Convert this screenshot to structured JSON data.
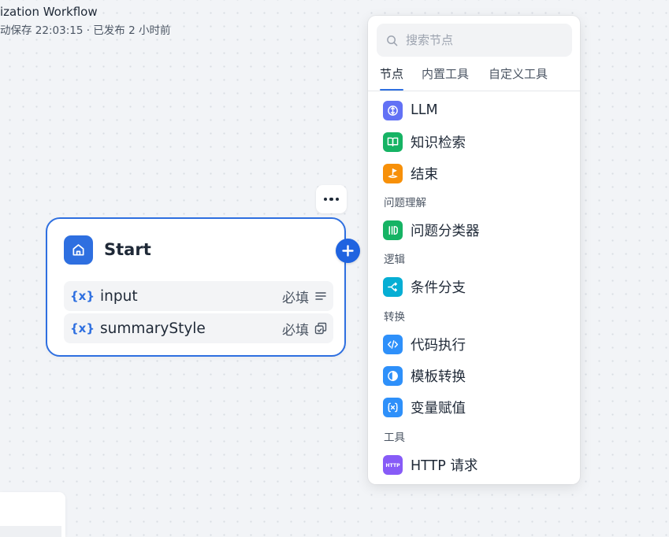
{
  "header": {
    "title": "ization Workflow",
    "subtitle": "动保存 22:03:15 · 已发布 2 小时前"
  },
  "start_node": {
    "title": "Start",
    "icon": "home-icon",
    "variables": [
      {
        "tag": "{x}",
        "name": "input",
        "required": "必填",
        "type_icon": "text-lines-icon"
      },
      {
        "tag": "{x}",
        "name": "summaryStyle",
        "required": "必填",
        "type_icon": "select-copy-icon"
      }
    ]
  },
  "panel": {
    "search_placeholder": "搜索节点",
    "tabs": [
      {
        "label": "节点",
        "active": true
      },
      {
        "label": "内置工具",
        "active": false
      },
      {
        "label": "自定义工具",
        "active": false
      }
    ],
    "items": [
      {
        "label": "LLM",
        "icon": "llm-icon",
        "color": "#6271f5"
      },
      {
        "label": "知识检索",
        "icon": "book-icon",
        "color": "#16b364"
      },
      {
        "label": "结束",
        "icon": "end-flag-icon",
        "color": "#f79009"
      },
      {
        "label": "问题分类器",
        "icon": "classifier-icon",
        "color": "#16b364"
      },
      {
        "label": "条件分支",
        "icon": "branch-icon",
        "color": "#06aed4"
      },
      {
        "label": "代码执行",
        "icon": "code-icon",
        "color": "#2e90fa"
      },
      {
        "label": "模板转换",
        "icon": "template-icon",
        "color": "#2e90fa"
      },
      {
        "label": "变量赋值",
        "icon": "variable-icon",
        "color": "#2e90fa"
      },
      {
        "label": "HTTP 请求",
        "icon": "http-icon",
        "color": "#875bf7"
      }
    ],
    "sections": [
      "问题理解",
      "逻辑",
      "转换",
      "工具"
    ]
  }
}
